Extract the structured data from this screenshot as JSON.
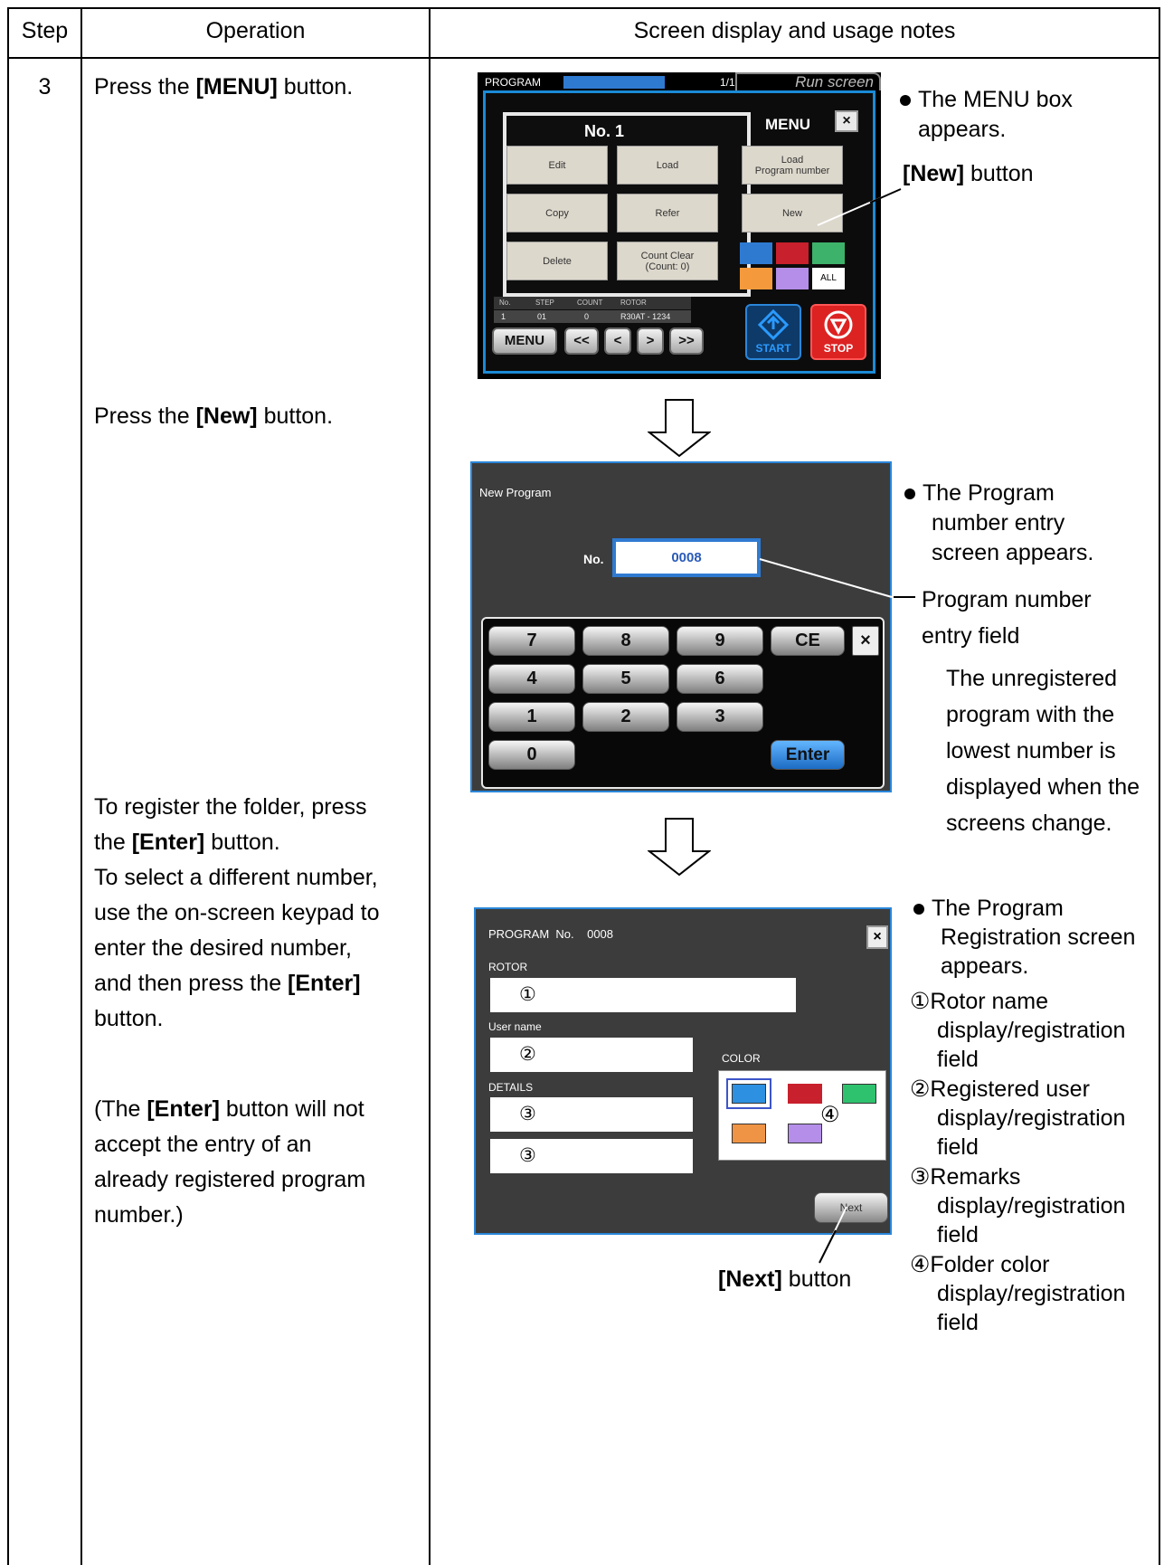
{
  "table": {
    "headers": {
      "step": "Step",
      "operation": "Operation",
      "screen": "Screen display and usage notes"
    },
    "step_number": "3"
  },
  "operations": {
    "op1_pre": "Press the ",
    "op1_bold": "[MENU]",
    "op1_post": " button.",
    "op2_pre": "Press the ",
    "op2_bold": "[New]",
    "op2_post": " button.",
    "op3_line1": "To register the folder, press",
    "op3_line2_pre": "the ",
    "op3_line2_bold": "[Enter]",
    "op3_line2_post": " button.",
    "op3_line3": "To select a different number,",
    "op3_line4": "use the on-screen keypad to",
    "op3_line5": "enter the desired number,",
    "op3_line6_pre": "and then press the ",
    "op3_line6_bold": "[Enter]",
    "op3_line7": "button.",
    "op4_line1_pre": "(The ",
    "op4_line1_bold": "[Enter]",
    "op4_line1_post": " button will not",
    "op4_line2": "accept the entry of an",
    "op4_line3": "already registered program",
    "op4_line4": "number.)"
  },
  "screen1": {
    "header_label": "PROGRAM",
    "page": "1/1",
    "run_tab": "Run screen",
    "program_no": "No. 1",
    "menu_title": "MENU",
    "close": "×",
    "buttons": {
      "edit": "Edit",
      "load": "Load",
      "copy": "Copy",
      "refer": "Refer",
      "delete": "Delete",
      "count_clear": "Count Clear\n(Count: 0)",
      "load_program_number": "Load\nProgram number",
      "new": "New"
    },
    "all": "ALL",
    "info_headers": {
      "no": "No.",
      "step": "STEP",
      "count": "COUNT",
      "rotor": "ROTOR"
    },
    "info_values": {
      "no": "1",
      "step": "01",
      "count": "0",
      "rotor": "R30AT - 1234"
    },
    "nav": {
      "menu": "MENU",
      "first": "<<",
      "prev": "<",
      "next": ">",
      "last": ">>"
    },
    "start": "START",
    "stop": "STOP",
    "colors": {
      "blue": "#2f7ad1",
      "red": "#c8202c",
      "green": "#3db26a",
      "orange": "#f59a3c",
      "purple": "#b48ee8",
      "white": "#ffffff"
    }
  },
  "screen2": {
    "title": "New Program",
    "no_label": "No.",
    "no_value": "0008",
    "keys": {
      "k7": "7",
      "k8": "8",
      "k9": "9",
      "ce": "CE",
      "close": "×",
      "k4": "4",
      "k5": "5",
      "k6": "6",
      "k1": "1",
      "k2": "2",
      "k3": "3",
      "k0": "0",
      "enter": "Enter"
    }
  },
  "screen3": {
    "header_program": "PROGRAM",
    "header_no": "No.",
    "header_value": "0008",
    "close": "×",
    "rotor_label": "ROTOR",
    "rotor_value": "①",
    "user_label": "User name",
    "user_value": "②",
    "details_label": "DETAILS",
    "details_value1": "③",
    "details_value2": "③",
    "color_label": "COLOR",
    "color_marker": "④",
    "next": "Next",
    "colors": {
      "blue": "#2e90e0",
      "red": "#c8202c",
      "green": "#2fc26e",
      "orange": "#ef9444",
      "purple": "#b48ee8"
    }
  },
  "notes": {
    "n1_line1": "The MENU box",
    "n1_line2": "appears.",
    "new_button_bold": "[New]",
    "new_button_text": " button",
    "n2_line1": "The Program",
    "n2_line2": "number entry",
    "n2_line3": "screen appears.",
    "field_line1": "Program number",
    "field_line2": "entry field",
    "unreg_line1": "The unregistered",
    "unreg_line2": "program with the",
    "unreg_line3": "lowest number is",
    "unreg_line4": "displayed when the",
    "unreg_line5": "screens change.",
    "n3_line1": "The Program",
    "n3_line2": "Registration screen",
    "n3_line3": "appears.",
    "i1_mark": "①",
    "i1_line1": "Rotor name",
    "i1_line2": "display/registration",
    "i1_line3": "field",
    "i2_mark": "②",
    "i2_line1": "Registered user",
    "i2_line2": "display/registration",
    "i2_line3": "field",
    "i3_mark": "③",
    "i3_line1": "Remarks",
    "i3_line2": "display/registration",
    "i3_line3": "field",
    "i4_mark": "④",
    "i4_line1": "Folder color",
    "i4_line2": "display/registration",
    "i4_line3": "field",
    "next_button_bold": "[Next]",
    "next_button_text": " button"
  }
}
